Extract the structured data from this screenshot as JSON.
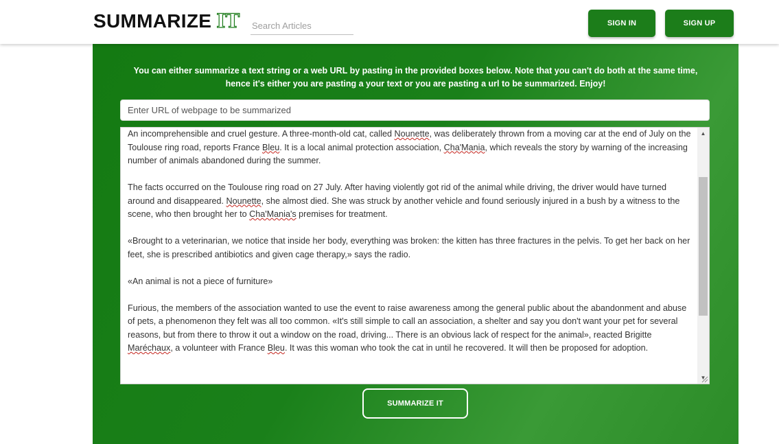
{
  "header": {
    "logo_main": "SUMMARIZE",
    "logo_accent": "IT",
    "search_placeholder": "Search Articles",
    "signin_label": "SIGN IN",
    "signup_label": "SIGN UP"
  },
  "main": {
    "intro_line1": "You can either summarize a text string or a web URL by pasting in the provided boxes below. Note that you can't do both at the same time,",
    "intro_line2": "hence it's either you are pasting a your text or you are pasting a url to be summarized. Enjoy!",
    "url_placeholder": "Enter URL of webpage to be summarized",
    "url_value": "",
    "summarize_label": "SUMMARIZE IT"
  },
  "article": {
    "p1": {
      "a": "An incomprehensible and cruel gesture. A three-month-old cat, called ",
      "b": "Nounette",
      "c": ", was deliberately thrown from a moving car at the end of July on the Toulouse ring road, reports France ",
      "d": "Bleu",
      "e": ". It is a local animal protection association, ",
      "f": "Cha'Mania",
      "g": ", which reveals the story by warning of the increasing number of animals abandoned during the summer."
    },
    "p2": {
      "a": "The facts occurred on the Toulouse ring road on 27 July. After having violently got rid of the animal while driving, the driver would have turned around and disappeared. ",
      "b": "Nounette",
      "c": ", she almost died. She was struck by another vehicle and found seriously injured in a bush by a witness to the scene, who then brought her to ",
      "d": "Cha'Mania's",
      "e": " premises for treatment."
    },
    "p3": "«Brought to a veterinarian, we notice that inside her body, everything was broken: the kitten has three fractures in the pelvis. To get her back on her feet, she is prescribed antibiotics and given cage therapy,» says the radio.",
    "p4": "«An animal is not a piece of furniture»",
    "p5": {
      "a": "Furious, the members of the association wanted to use the event to raise awareness among the general public about the abandonment and abuse of pets, a phenomenon they felt was all too common. «It's still simple to call an association, a shelter and say you don't want your pet for several reasons, but from there to throw it out a window on the road, driving... There is an obvious lack of respect for the animal», reacted Brigitte ",
      "b": "Maréchaux",
      "c": ", a volunteer with France ",
      "d": "Bleu",
      "e": ". It was this woman who took the cat in until he recovered. It will then be proposed for adoption."
    }
  },
  "icons": {
    "scroll_up": "scroll-up-arrow-icon",
    "scroll_down": "scroll-down-arrow-icon",
    "resize": "resize-grip-icon"
  },
  "colors": {
    "brand_green": "#1c7d1a",
    "panel_green": "#147a12",
    "spellcheck_red": "#c4231c"
  }
}
